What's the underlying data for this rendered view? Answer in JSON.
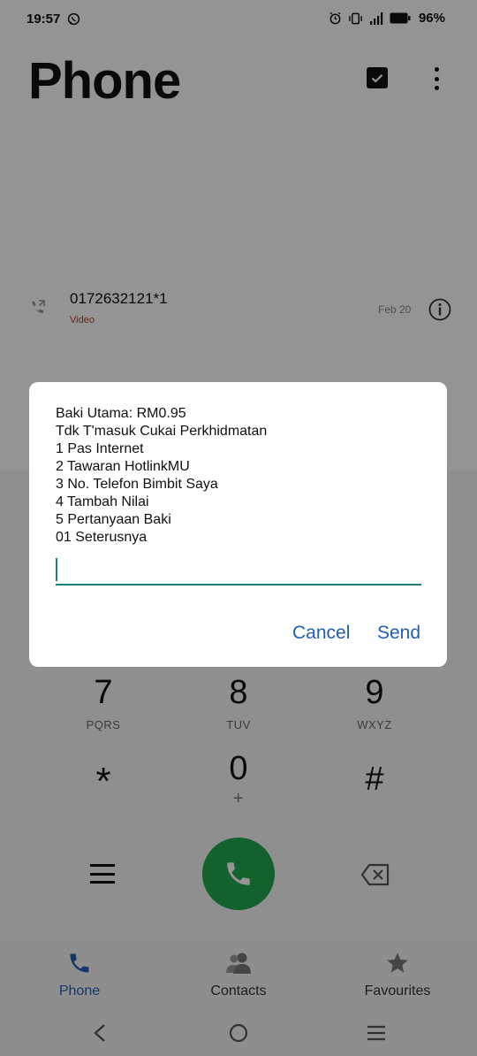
{
  "status_bar": {
    "time": "19:57",
    "battery": "96%",
    "icons": [
      "whatsapp-icon",
      "alarm-icon",
      "vibrate-icon",
      "signal-icon",
      "battery-icon"
    ]
  },
  "header": {
    "title": "Phone"
  },
  "recent_calls": [
    {
      "number": "0172632121*1",
      "type": "Video",
      "date": "Feb 20"
    }
  ],
  "dialpad": {
    "keys": [
      {
        "digit": "7",
        "letters": "PQRS"
      },
      {
        "digit": "8",
        "letters": "TUV"
      },
      {
        "digit": "9",
        "letters": "WXYZ"
      },
      {
        "digit": "*",
        "letters": ""
      },
      {
        "digit": "0",
        "letters": "+"
      },
      {
        "digit": "#",
        "letters": ""
      }
    ]
  },
  "bottom_nav": {
    "items": [
      {
        "label": "Phone",
        "icon": "phone-icon",
        "active": true
      },
      {
        "label": "Contacts",
        "icon": "contacts-icon",
        "active": false
      },
      {
        "label": "Favourites",
        "icon": "star-icon",
        "active": false
      }
    ]
  },
  "dialog": {
    "message": "Baki Utama: RM0.95\nTdk T'masuk Cukai Perkhidmatan\n1 Pas Internet\n2 Tawaran HotlinkMU\n3 No. Telefon Bimbit Saya\n4 Tambah Nilai\n5 Pertanyaan Baki\n01 Seterusnya",
    "input_value": "",
    "cancel_label": "Cancel",
    "send_label": "Send"
  },
  "colors": {
    "accent": "#1f5fb4",
    "input_underline": "#1b7f74",
    "call_button": "#21a84d",
    "video_label": "#c0392b"
  }
}
